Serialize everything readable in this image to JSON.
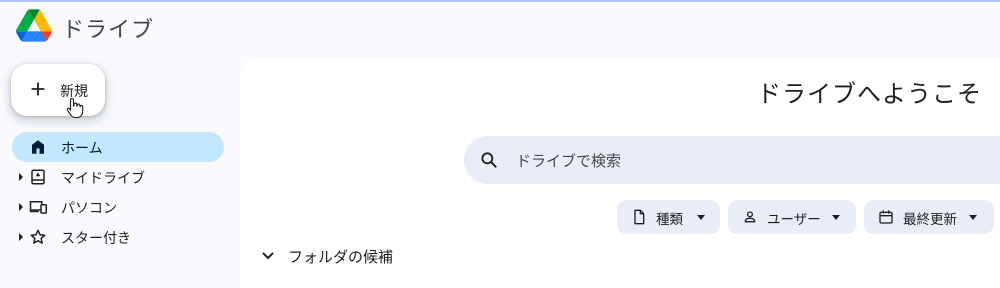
{
  "app": {
    "title": "ドライブ"
  },
  "sidebar": {
    "new_label": "新規",
    "items": [
      {
        "label": "ホーム",
        "icon": "home-icon",
        "active": true
      },
      {
        "label": "マイドライブ",
        "icon": "my-drive-icon"
      },
      {
        "label": "パソコン",
        "icon": "computers-icon"
      },
      {
        "label": "スター付き",
        "icon": "star-icon"
      }
    ]
  },
  "main": {
    "welcome": "ドライブへようこそ",
    "search": {
      "placeholder": "ドライブで検索"
    },
    "filters": [
      {
        "label": "種類",
        "icon": "file-type-icon"
      },
      {
        "label": "ユーザー",
        "icon": "person-icon"
      },
      {
        "label": "最終更新",
        "icon": "calendar-icon"
      }
    ],
    "suggested_folders": "フォルダの候補"
  },
  "colors": {
    "accent_nav": "#c2e7ff",
    "search_bg": "#e9eef6",
    "page_bg": "#f8fafd"
  }
}
